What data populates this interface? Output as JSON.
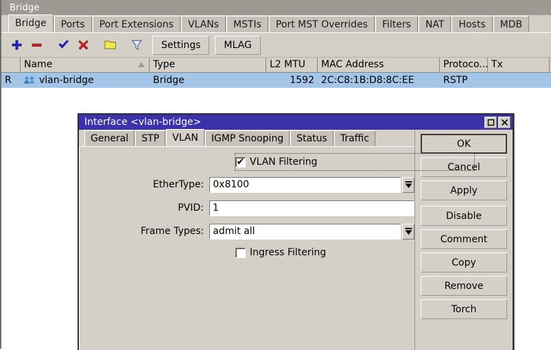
{
  "main_window": {
    "title": "Bridge",
    "tabs": [
      {
        "label": "Bridge",
        "active": true
      },
      {
        "label": "Ports",
        "active": false
      },
      {
        "label": "Port Extensions",
        "active": false
      },
      {
        "label": "VLANs",
        "active": false
      },
      {
        "label": "MSTIs",
        "active": false
      },
      {
        "label": "Port MST Overrides",
        "active": false
      },
      {
        "label": "Filters",
        "active": false
      },
      {
        "label": "NAT",
        "active": false
      },
      {
        "label": "Hosts",
        "active": false
      },
      {
        "label": "MDB",
        "active": false
      }
    ],
    "toolbar": {
      "add_icon": "plus-icon",
      "remove_icon": "minus-icon",
      "enable_icon": "check-icon",
      "disable_icon": "cross-icon",
      "comment_icon": "note-icon",
      "filter_icon": "funnel-icon",
      "settings_label": "Settings",
      "mlag_label": "MLAG"
    },
    "table": {
      "columns": [
        "",
        "Name",
        "Type",
        "L2 MTU",
        "MAC Address",
        "Protoco...",
        "Tx"
      ],
      "sorted_column": "Name",
      "rows": [
        {
          "flag": "R",
          "icon": "bridge-icon",
          "name": "vlan-bridge",
          "type": "Bridge",
          "l2_mtu": "1592",
          "mac_address": "2C:C8:1B:D8:8C:EE",
          "protocol": "RSTP",
          "tx": "",
          "selected": true
        }
      ]
    }
  },
  "dialog": {
    "title": "Interface <vlan-bridge>",
    "window_buttons": {
      "maximize_icon": "maximize-icon",
      "close_icon": "close-icon"
    },
    "tabs": [
      {
        "label": "General",
        "active": false
      },
      {
        "label": "STP",
        "active": false
      },
      {
        "label": "VLAN",
        "active": true
      },
      {
        "label": "IGMP Snooping",
        "active": false
      },
      {
        "label": "Status",
        "active": false
      },
      {
        "label": "Traffic",
        "active": false
      }
    ],
    "form": {
      "vlan_filtering": {
        "label": "VLAN Filtering",
        "checked": true,
        "check_glyph": "✔"
      },
      "ethertype": {
        "label": "EtherType:",
        "value": "0x8100",
        "has_dropdown": true
      },
      "pvid": {
        "label": "PVID:",
        "value": "1",
        "has_dropdown": false
      },
      "frame_types": {
        "label": "Frame Types:",
        "value": "admit all",
        "has_dropdown": true
      },
      "ingress_filtering": {
        "label": "Ingress Filtering",
        "checked": false,
        "check_glyph": ""
      }
    },
    "buttons": [
      {
        "label": "OK",
        "default": true,
        "gap": false
      },
      {
        "label": "Cancel",
        "default": false,
        "gap": false
      },
      {
        "label": "Apply",
        "default": false,
        "gap": false
      },
      {
        "label": "Disable",
        "default": false,
        "gap": true
      },
      {
        "label": "Comment",
        "default": false,
        "gap": false
      },
      {
        "label": "Copy",
        "default": false,
        "gap": false
      },
      {
        "label": "Remove",
        "default": false,
        "gap": false
      },
      {
        "label": "Torch",
        "default": false,
        "gap": false
      }
    ]
  },
  "colors": {
    "window_bg": "#d4d0c8",
    "title_inactive": "#9e9a93",
    "title_active": "#3b31a8",
    "selection": "#a3c6e8",
    "accent_blue": "#2222cc",
    "accent_red": "#cc2222",
    "accent_yellow": "#f2e74b"
  }
}
